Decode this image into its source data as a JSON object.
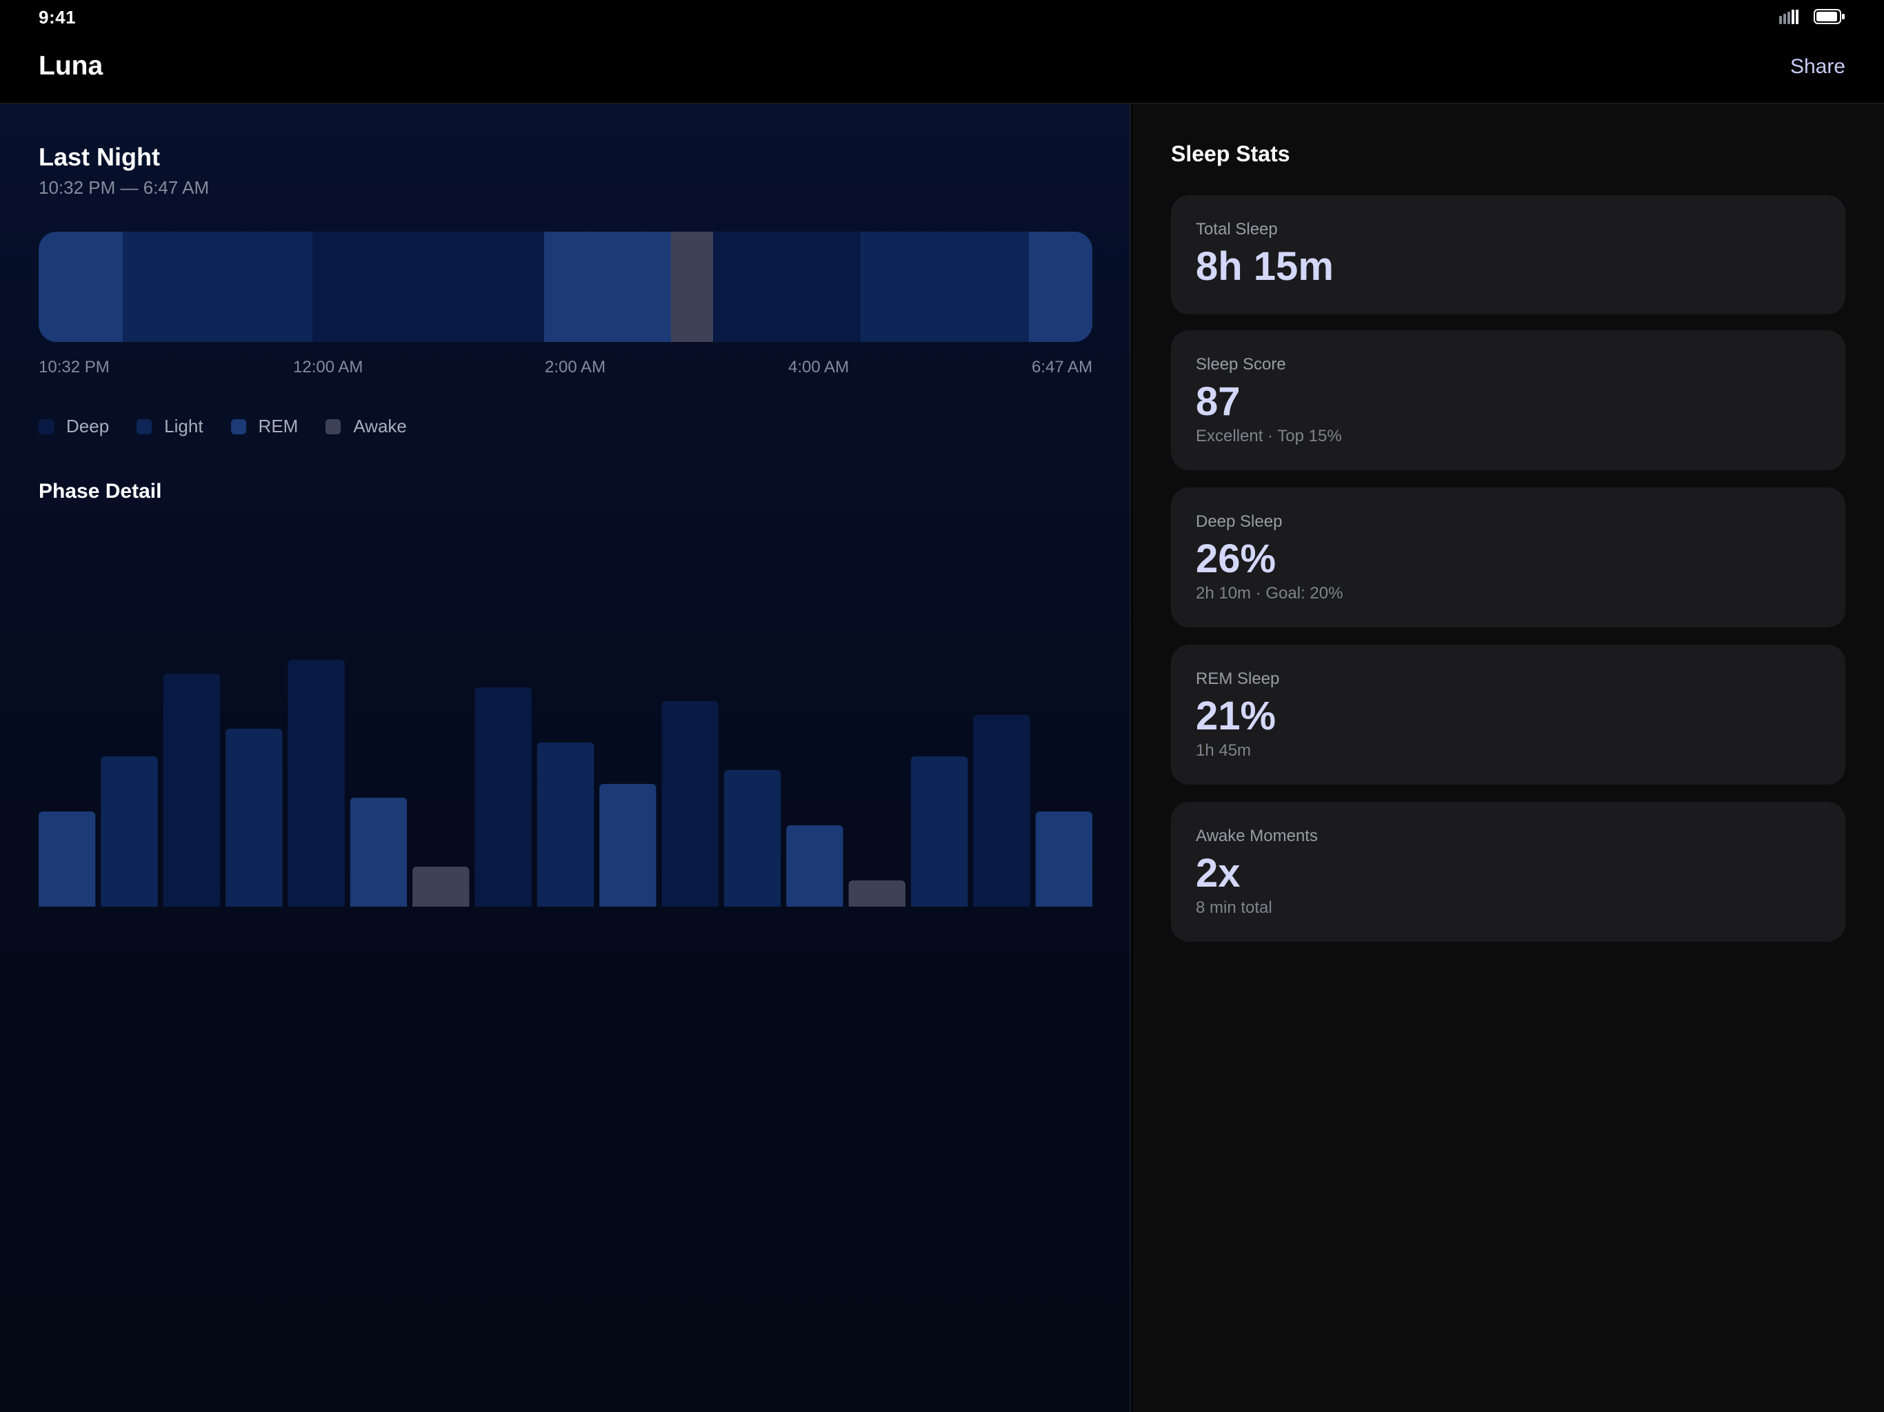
{
  "status_bar": {
    "time": "9:41"
  },
  "nav": {
    "title": "Luna",
    "share_label": "Share"
  },
  "colors": {
    "deep": "#081a44",
    "light": "#0e2657",
    "rem": "#1b3a76",
    "awake": "#3d4257",
    "accent": "#c6cdf5"
  },
  "last_night": {
    "title": "Last Night",
    "time_range": "10:32 PM — 6:47 AM",
    "ticks": [
      "10:32 PM",
      "12:00 AM",
      "2:00 AM",
      "4:00 AM",
      "6:47 AM"
    ],
    "timeline": [
      {
        "phase": "rem",
        "fraction": 0.08
      },
      {
        "phase": "light",
        "fraction": 0.18
      },
      {
        "phase": "deep",
        "fraction": 0.22
      },
      {
        "phase": "rem",
        "fraction": 0.12
      },
      {
        "phase": "awake",
        "fraction": 0.04
      },
      {
        "phase": "deep",
        "fraction": 0.14
      },
      {
        "phase": "light",
        "fraction": 0.16
      },
      {
        "phase": "rem",
        "fraction": 0.06
      }
    ]
  },
  "legend": [
    {
      "key": "deep",
      "label": "Deep"
    },
    {
      "key": "light",
      "label": "Light"
    },
    {
      "key": "rem",
      "label": "REM"
    },
    {
      "key": "awake",
      "label": "Awake"
    }
  ],
  "phase_detail": {
    "title": "Phase Detail"
  },
  "chart_data": {
    "type": "bar",
    "bars": [
      {
        "phase": "rem",
        "value": 40
      },
      {
        "phase": "light",
        "value": 60
      },
      {
        "phase": "deep",
        "value": 90
      },
      {
        "phase": "light",
        "value": 70
      },
      {
        "phase": "deep",
        "value": 95
      },
      {
        "phase": "rem",
        "value": 45
      },
      {
        "phase": "awake",
        "value": 20
      },
      {
        "phase": "deep",
        "value": 85
      },
      {
        "phase": "light",
        "value": 65
      },
      {
        "phase": "rem",
        "value": 50
      },
      {
        "phase": "deep",
        "value": 80
      },
      {
        "phase": "light",
        "value": 55
      },
      {
        "phase": "rem",
        "value": 35
      },
      {
        "phase": "awake",
        "value": 15
      },
      {
        "phase": "light",
        "value": 60
      },
      {
        "phase": "deep",
        "value": 75
      },
      {
        "phase": "rem",
        "value": 40
      }
    ],
    "ylim": [
      0,
      100
    ],
    "grid": false
  },
  "stats": {
    "title": "Sleep Stats",
    "cards": [
      {
        "label": "Total Sleep",
        "value": "8h 15m",
        "sub": ""
      },
      {
        "label": "Sleep Score",
        "value": "87",
        "sub": "Excellent · Top 15%"
      },
      {
        "label": "Deep Sleep",
        "value": "26%",
        "sub": "2h 10m · Goal: 20%"
      },
      {
        "label": "REM Sleep",
        "value": "21%",
        "sub": "1h 45m"
      },
      {
        "label": "Awake Moments",
        "value": "2x",
        "sub": "8 min total"
      }
    ]
  }
}
